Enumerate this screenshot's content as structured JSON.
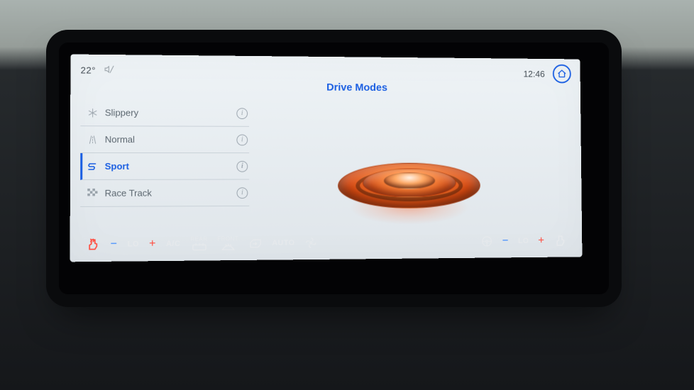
{
  "status": {
    "temperature": "22°",
    "mute_icon": "mute-icon",
    "clock": "12:46"
  },
  "page": {
    "title": "Drive Modes"
  },
  "modes": {
    "selected_index": 2,
    "items": [
      {
        "label": "Slippery",
        "icon": "snowflake"
      },
      {
        "label": "Normal",
        "icon": "road"
      },
      {
        "label": "Sport",
        "icon": "s-badge"
      },
      {
        "label": "Race Track",
        "icon": "checkered-flag"
      }
    ]
  },
  "climate": {
    "left_seat_heat": "on",
    "left_temp": "LO",
    "ac_label": "A/C",
    "rear_label": "REAR",
    "front_label": "FRONT",
    "auto_label": "AUTO",
    "right_temp": "LO",
    "right_seat_heat": "off"
  },
  "colors": {
    "accent": "#1b5fe2",
    "sport_orange": "#ff6a1f"
  }
}
